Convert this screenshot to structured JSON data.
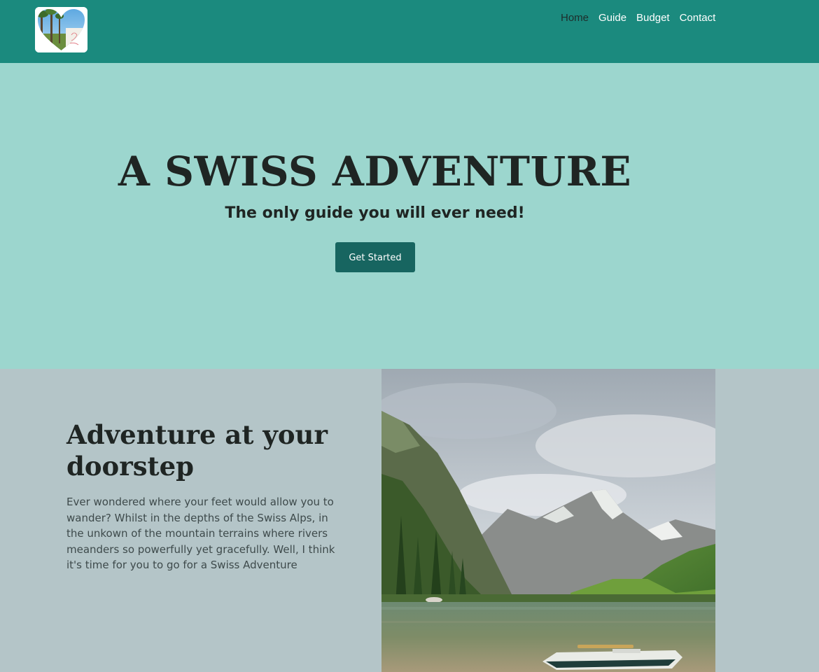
{
  "nav": {
    "items": [
      {
        "label": "Home",
        "active": true
      },
      {
        "label": "Guide",
        "active": false
      },
      {
        "label": "Budget",
        "active": false
      },
      {
        "label": "Contact",
        "active": false
      }
    ]
  },
  "hero": {
    "title": "A SWISS ADVENTURE",
    "subtitle": "The only guide you will ever need!",
    "cta_label": "Get Started"
  },
  "feature": {
    "heading": "Adventure at your doorstep",
    "body": "Ever wondered where your feet would allow you to wander? Whilst in the depths of the Swiss Alps, in the unkown of the mountain terrains where rivers meanders so powerfully yet gracefully. Well, I think it's time for you to go for a Swiss Adventure"
  },
  "colors": {
    "navbar": "#1b8a7e",
    "hero_bg": "#9cd6ce",
    "feature_bg": "#b4c5c8",
    "button_bg": "#176560"
  },
  "icons": {
    "logo": "heart-photo-logo"
  }
}
